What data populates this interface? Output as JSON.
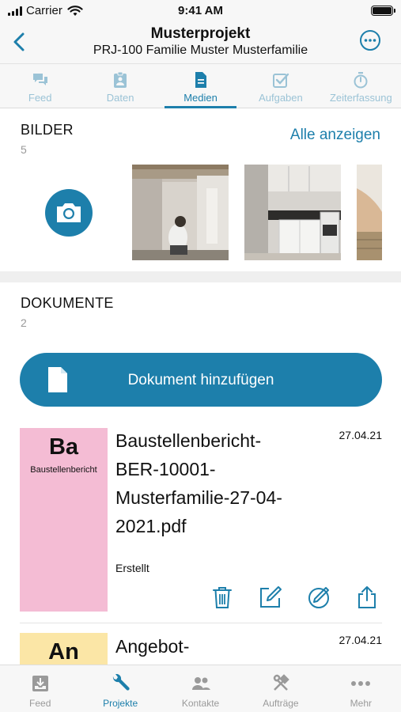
{
  "status_bar": {
    "carrier": "Carrier",
    "time": "9:41 AM"
  },
  "header": {
    "title": "Musterprojekt",
    "subtitle": "PRJ-100 Familie Muster Musterfamilie"
  },
  "top_tabs": [
    {
      "label": "Feed",
      "icon": "chat-icon"
    },
    {
      "label": "Daten",
      "icon": "clipboard-icon"
    },
    {
      "label": "Medien",
      "icon": "document-icon",
      "active": true
    },
    {
      "label": "Aufgaben",
      "icon": "checkbox-icon"
    },
    {
      "label": "Zeiterfassung",
      "icon": "stopwatch-icon"
    }
  ],
  "images_section": {
    "title": "BILDER",
    "count": "5",
    "show_all": "Alle anzeigen"
  },
  "documents_section": {
    "title": "DOKUMENTE",
    "count": "2",
    "add_button": "Dokument hinzufügen"
  },
  "documents": [
    {
      "abbr": "Ba",
      "type_label": "Baustellenbericht",
      "name": "Baustellenbericht-BER-10001-Musterfamilie-27-04-2021.pdf",
      "name_lines": [
        "Baustellenbericht-",
        "BER-10001-",
        "Musterfamilie-27-04-",
        "2021.pdf"
      ],
      "date": "27.04.21",
      "status": "Erstellt",
      "thumb_color": "#f4bcd4"
    },
    {
      "abbr": "An",
      "name_lines": [
        "Angebot-"
      ],
      "date": "27.04.21",
      "thumb_color": "#fbe6a6"
    }
  ],
  "bottom_tabs": [
    {
      "label": "Feed",
      "icon": "inbox-icon"
    },
    {
      "label": "Projekte",
      "icon": "wrench-icon",
      "active": true
    },
    {
      "label": "Kontakte",
      "icon": "people-icon"
    },
    {
      "label": "Aufträge",
      "icon": "tools-icon"
    },
    {
      "label": "Mehr",
      "icon": "more-dots-icon"
    }
  ],
  "colors": {
    "accent": "#1d7fab",
    "accent_light": "#9bc3d6"
  }
}
